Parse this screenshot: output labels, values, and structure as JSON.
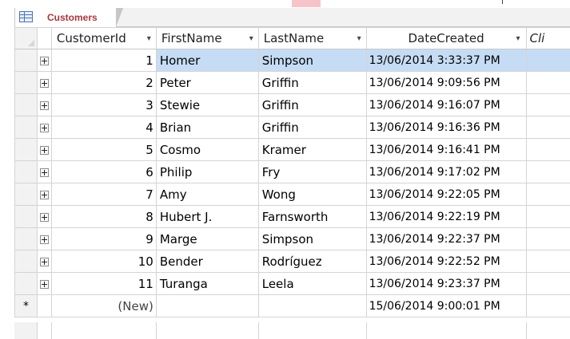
{
  "tab": {
    "title": "Customers",
    "icon": "table-icon"
  },
  "columns": [
    {
      "label": "CustomerId",
      "has_dropdown": true
    },
    {
      "label": "FirstName",
      "has_dropdown": true
    },
    {
      "label": "LastName",
      "has_dropdown": true
    },
    {
      "label": "DateCreated",
      "has_dropdown": true
    },
    {
      "label": "Cli",
      "has_dropdown": false
    }
  ],
  "rows": [
    {
      "id": "1",
      "first": "Homer",
      "last": "Simpson",
      "date": "13/06/2014 3:33:37 PM",
      "current": true
    },
    {
      "id": "2",
      "first": "Peter",
      "last": "Griffin",
      "date": "13/06/2014 9:09:56 PM"
    },
    {
      "id": "3",
      "first": "Stewie",
      "last": "Griffin",
      "date": "13/06/2014 9:16:07 PM"
    },
    {
      "id": "4",
      "first": "Brian",
      "last": "Griffin",
      "date": "13/06/2014 9:16:36 PM"
    },
    {
      "id": "5",
      "first": "Cosmo",
      "last": "Kramer",
      "date": "13/06/2014 9:16:41 PM"
    },
    {
      "id": "6",
      "first": "Philip",
      "last": "Fry",
      "date": "13/06/2014 9:17:02 PM"
    },
    {
      "id": "7",
      "first": "Amy",
      "last": "Wong",
      "date": "13/06/2014 9:22:05 PM"
    },
    {
      "id": "8",
      "first": "Hubert J.",
      "last": "Farnsworth",
      "date": "13/06/2014 9:22:19 PM"
    },
    {
      "id": "9",
      "first": "Marge",
      "last": "Simpson",
      "date": "13/06/2014 9:22:37 PM"
    },
    {
      "id": "10",
      "first": "Bender",
      "last": "Rodríguez",
      "date": "13/06/2014 9:22:52 PM"
    },
    {
      "id": "11",
      "first": "Turanga",
      "last": "Leela",
      "date": "13/06/2014 9:23:37 PM"
    }
  ],
  "new_row": {
    "marker": "*",
    "id": "(New)",
    "date": "15/06/2014 9:00:01 PM"
  },
  "colors": {
    "tab_title": "#a4373a",
    "selection": "#c5dcf4",
    "selector_bg": "#f2f2f2"
  }
}
